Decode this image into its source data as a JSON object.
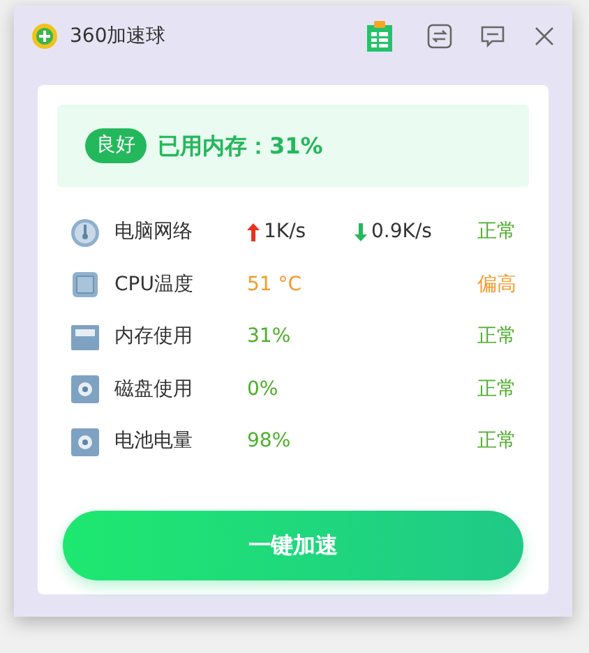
{
  "window": {
    "title": "360加速球"
  },
  "summary": {
    "badge": "良好",
    "text": "已用内存：31%"
  },
  "metrics": [
    {
      "kind": "network",
      "label": "电脑网络",
      "upload": "1K/s",
      "download": "0.9K/s",
      "status": "正常",
      "alert": false
    },
    {
      "kind": "cpu",
      "label": "CPU温度",
      "value": "51 °C",
      "status": "偏高",
      "alert": true
    },
    {
      "kind": "memory",
      "label": "内存使用",
      "value": "31%",
      "status": "正常",
      "alert": false
    },
    {
      "kind": "disk",
      "label": "磁盘使用",
      "value": "0%",
      "status": "正常",
      "alert": false
    },
    {
      "kind": "battery",
      "label": "电池电量",
      "value": "98%",
      "status": "正常",
      "alert": false
    }
  ],
  "button": "一键加速"
}
